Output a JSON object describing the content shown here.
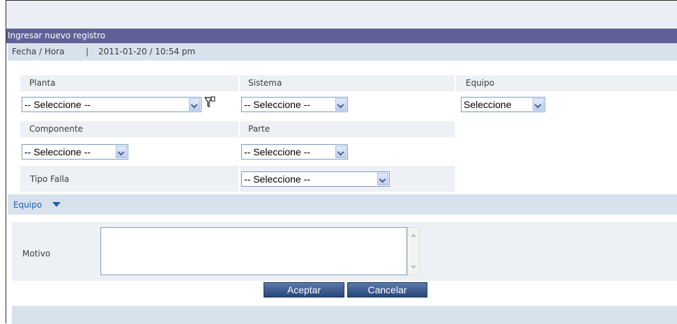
{
  "panel": {
    "title": "Ingresar nuevo registro"
  },
  "fecha": {
    "label": "Fecha / Hora",
    "separator": "|",
    "value": "2011-01-20 / 10:54 pm"
  },
  "fields": {
    "planta": {
      "label": "Planta",
      "value": "-- Seleccione --"
    },
    "sistema": {
      "label": "Sistema",
      "value": "-- Seleccione --"
    },
    "equipo": {
      "label": "Equipo",
      "value": "Seleccione"
    },
    "componente": {
      "label": "Componente",
      "value": "-- Seleccione --"
    },
    "parte": {
      "label": "Parte",
      "value": "-- Seleccione --"
    },
    "tipo_falla": {
      "label": "Tipo Falla",
      "value": "-- Seleccione --"
    }
  },
  "equipo_section": {
    "label": "Equipo"
  },
  "motivo": {
    "label": "Motivo",
    "value": ""
  },
  "buttons": {
    "aceptar": "Aceptar",
    "cancelar": "Cancelar"
  },
  "colors": {
    "title_bar": "#5f6197",
    "band": "#d8e2ec",
    "cell": "#edf1f5",
    "link": "#1e5fb5",
    "button": "#27477a"
  }
}
